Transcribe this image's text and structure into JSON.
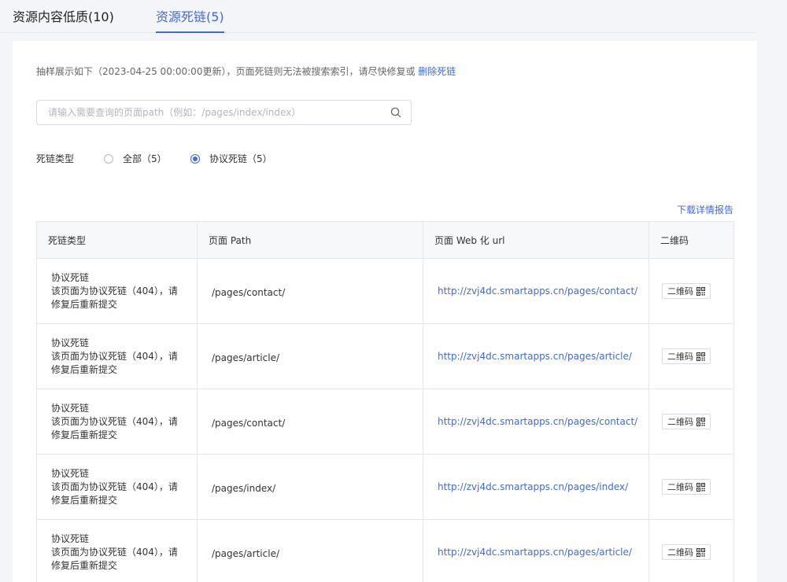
{
  "tabs": [
    {
      "label": "资源内容低质(10)"
    },
    {
      "label": "资源死链(5)"
    }
  ],
  "notice": {
    "text": "抽样展示如下（2023-04-25 00:00:00更新），页面死链则无法被搜索索引，请尽快修复或",
    "link": "删除死链"
  },
  "search": {
    "placeholder": "请输入需要查询的页面path（例如：/pages/index/index）",
    "value": ""
  },
  "filter": {
    "label": "死链类型",
    "options": [
      {
        "label": "全部（5）",
        "selected": false
      },
      {
        "label": "协议死链（5）",
        "selected": true
      }
    ]
  },
  "download_label": "下载详情报告",
  "table": {
    "headers": [
      "死链类型",
      "页面 Path",
      "页面 Web 化 url",
      "二维码"
    ],
    "qr_label": "二维码",
    "rows": [
      {
        "type": "协议死链",
        "desc1": "该页面为协议死链（404），请",
        "desc2": "修复后重新提交",
        "path": "/pages/contact/",
        "url": "http://zvj4dc.smartapps.cn/pages/contact/"
      },
      {
        "type": "协议死链",
        "desc1": "该页面为协议死链（404），请",
        "desc2": "修复后重新提交",
        "path": "/pages/article/",
        "url": "http://zvj4dc.smartapps.cn/pages/article/"
      },
      {
        "type": "协议死链",
        "desc1": "该页面为协议死链（404），请",
        "desc2": "修复后重新提交",
        "path": "/pages/contact/",
        "url": "http://zvj4dc.smartapps.cn/pages/contact/"
      },
      {
        "type": "协议死链",
        "desc1": "该页面为协议死链（404），请",
        "desc2": "修复后重新提交",
        "path": "/pages/index/",
        "url": "http://zvj4dc.smartapps.cn/pages/index/"
      },
      {
        "type": "协议死链",
        "desc1": "该页面为协议死链（404），请",
        "desc2": "修复后重新提交",
        "path": "/pages/article/",
        "url": "http://zvj4dc.smartapps.cn/pages/article/"
      }
    ]
  },
  "colors": {
    "accent": "#3f6ae0",
    "background": "#f4f5f9"
  }
}
